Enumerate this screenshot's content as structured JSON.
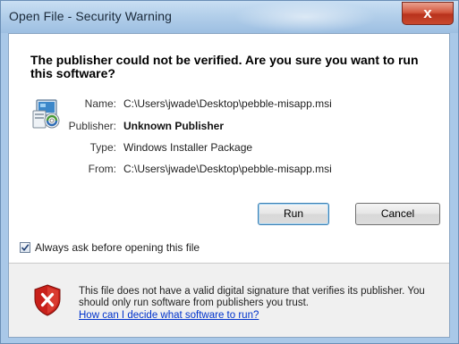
{
  "window": {
    "title": "Open File - Security Warning",
    "close_label": "x"
  },
  "headline": "The publisher could not be verified.  Are you sure you want to run this software?",
  "file_info": [
    {
      "label": "Name:",
      "value": "C:\\Users\\jwade\\Desktop\\pebble-misapp.msi",
      "bold": false
    },
    {
      "label": "Publisher:",
      "value": "Unknown Publisher",
      "bold": true
    },
    {
      "label": "Type:",
      "value": "Windows Installer Package",
      "bold": false
    },
    {
      "label": "From:",
      "value": "C:\\Users\\jwade\\Desktop\\pebble-misapp.msi",
      "bold": false
    }
  ],
  "buttons": {
    "run": "Run",
    "cancel": "Cancel"
  },
  "checkbox": {
    "label": "Always ask before opening this file",
    "checked": true
  },
  "footer": {
    "warning_text": "This file does not have a valid digital signature that verifies its publisher.  You should only run software from publishers you trust.",
    "link_text": "How can I decide what software to run?"
  },
  "icons": {
    "installer": "windows-installer-icon",
    "shield": "security-shield-icon",
    "checkmark": "checkmark-icon"
  },
  "colors": {
    "titlebar": "#b3cfea",
    "close_button": "#c9492e",
    "link": "#0033cc",
    "footer_bg": "#f0f0f0",
    "shield_red": "#c8201a"
  }
}
